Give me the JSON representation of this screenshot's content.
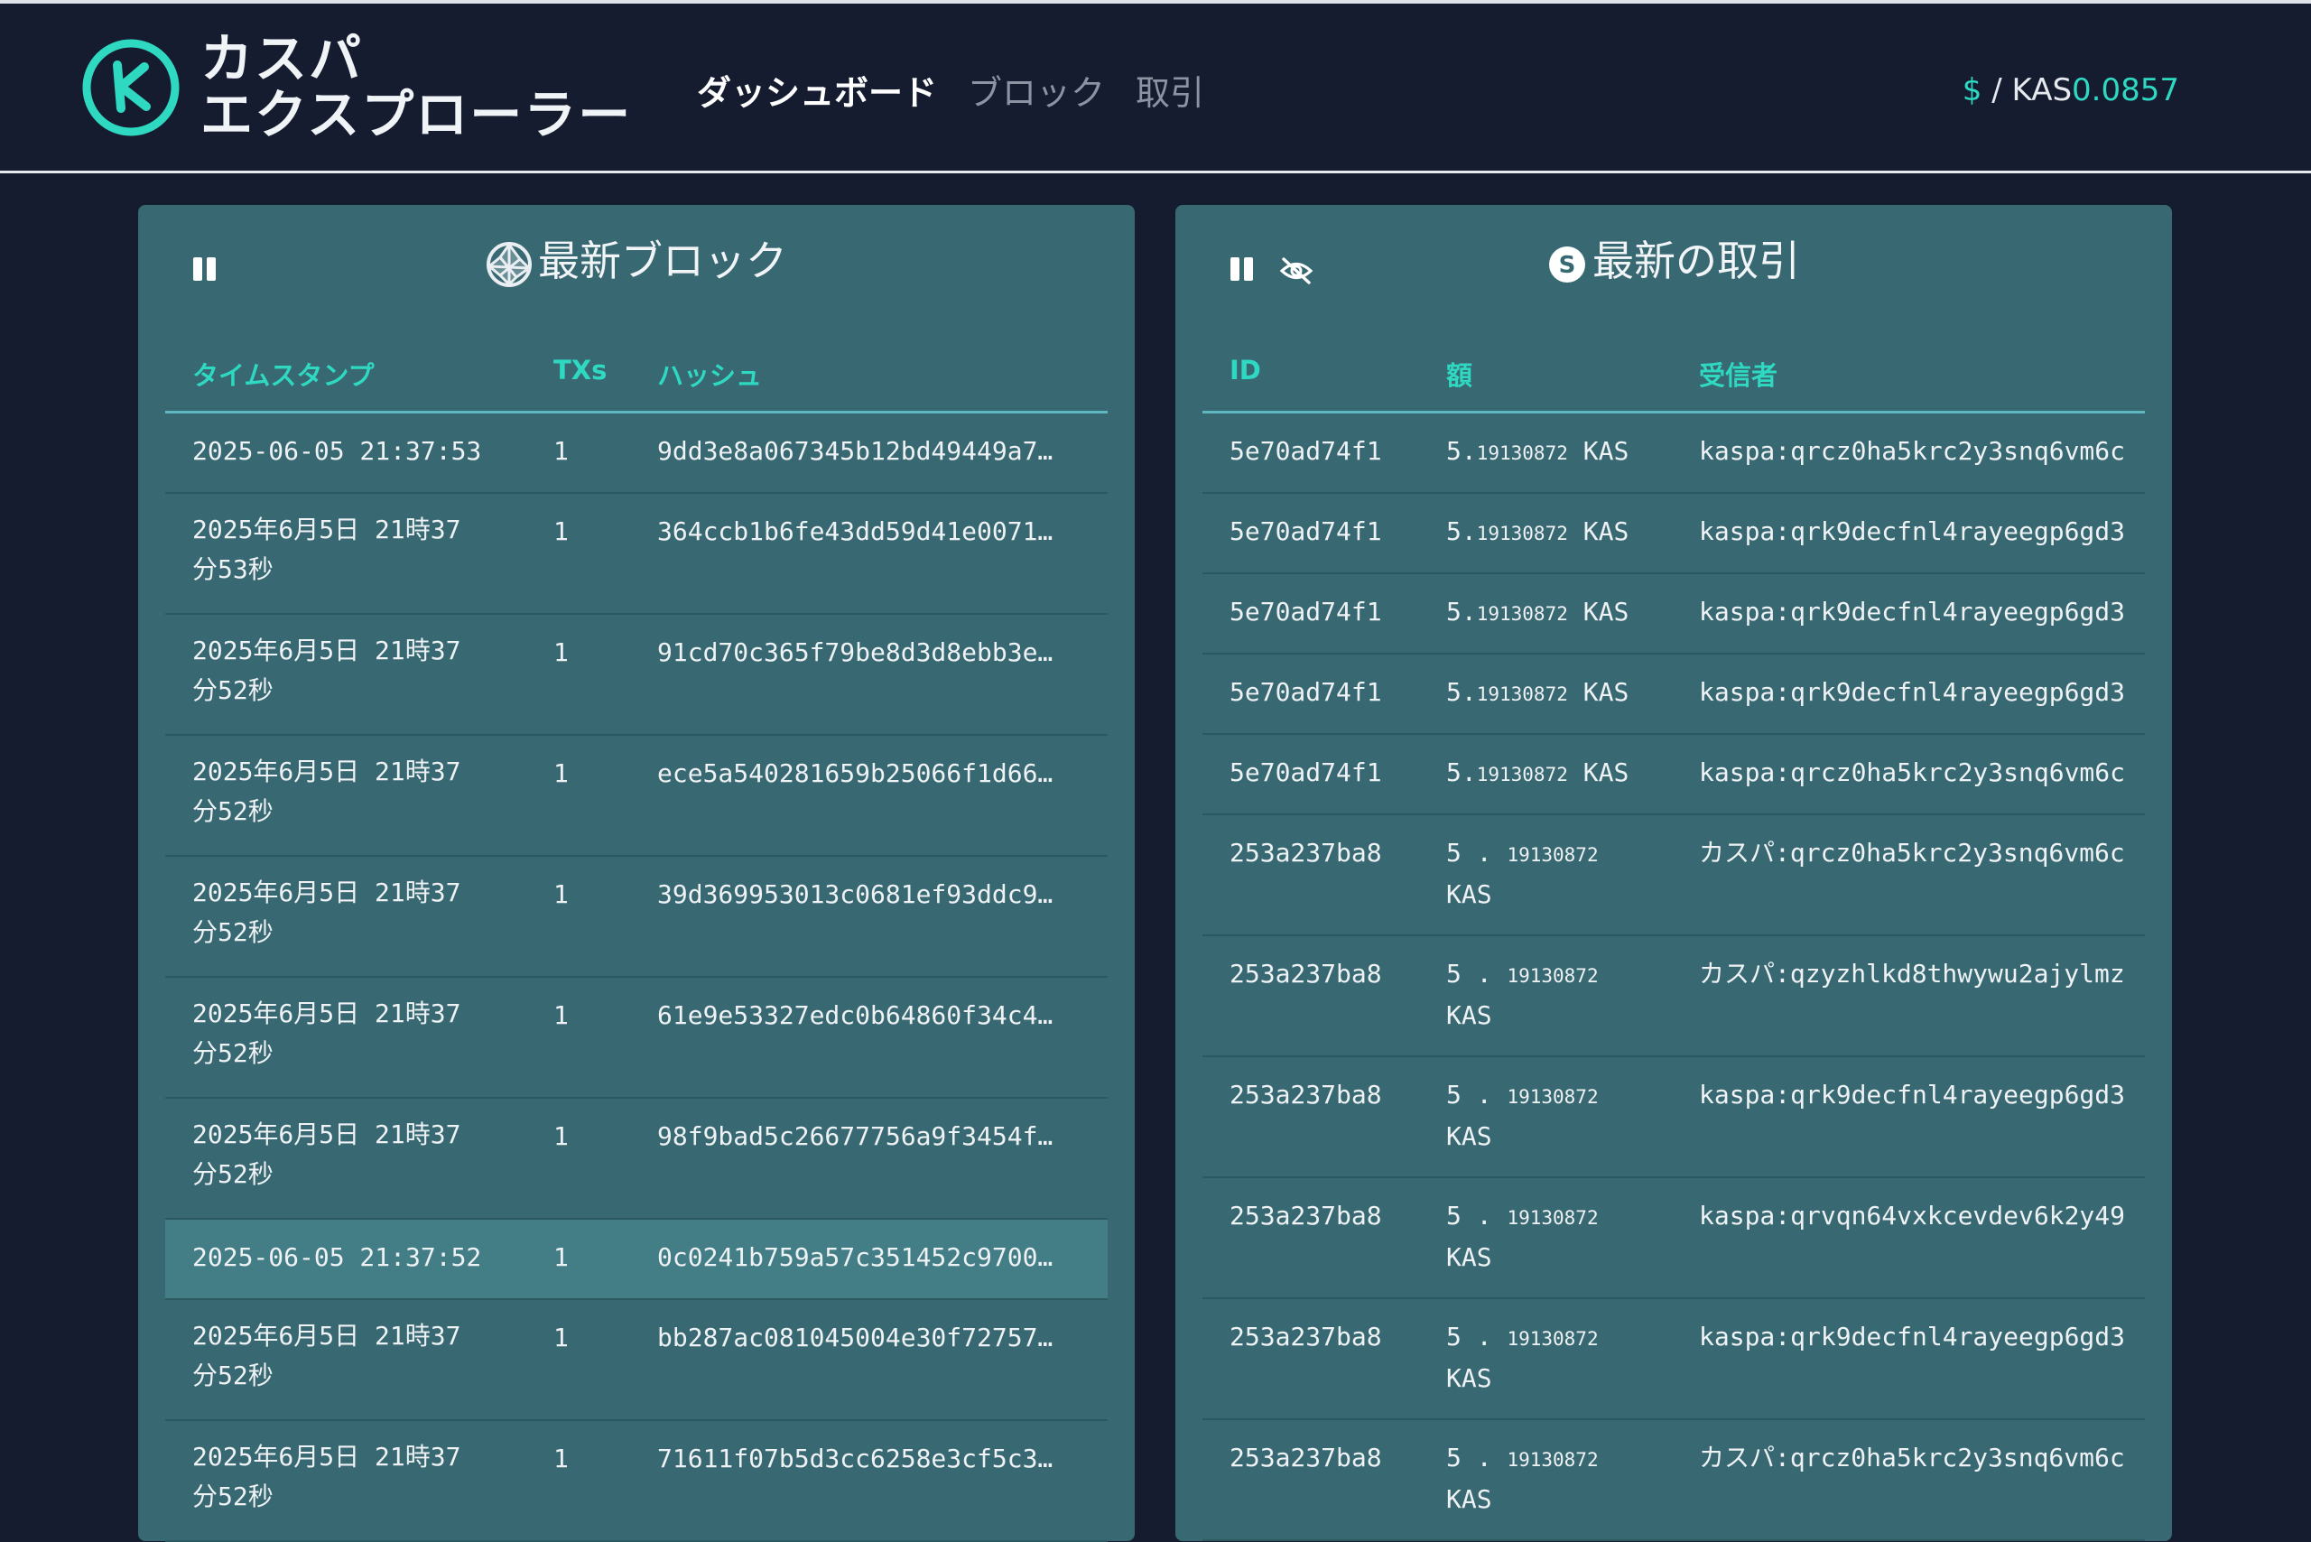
{
  "header": {
    "brand_line1": "カスパ",
    "brand_line2": "エクスプローラー",
    "nav": [
      "ダッシュボード",
      "ブロック",
      "取引"
    ],
    "price_currency": "$",
    "price_sep": " / KAS",
    "price_value": "0.0857"
  },
  "blocks_panel": {
    "title": "最新ブロック",
    "columns": [
      "タイムスタンプ",
      "TXs",
      "ハッシュ"
    ],
    "rows": [
      {
        "ts1": "2025-06-05 21:37:53",
        "ts2": "",
        "txs": "1",
        "hash": "9dd3e8a067345b12bd49449a7…"
      },
      {
        "ts1": "2025年6月5日 21時37",
        "ts2": "分53秒",
        "txs": "1",
        "hash": "364ccb1b6fe43dd59d41e0071…"
      },
      {
        "ts1": "2025年6月5日 21時37",
        "ts2": "分52秒",
        "txs": "1",
        "hash": "91cd70c365f79be8d3d8ebb3e…"
      },
      {
        "ts1": "2025年6月5日 21時37",
        "ts2": "分52秒",
        "txs": "1",
        "hash": "ece5a540281659b25066f1d66…"
      },
      {
        "ts1": "2025年6月5日 21時37",
        "ts2": "分52秒",
        "txs": "1",
        "hash": "39d369953013c0681ef93ddc9…"
      },
      {
        "ts1": "2025年6月5日 21時37",
        "ts2": "分52秒",
        "txs": "1",
        "hash": "61e9e53327edc0b64860f34c4…"
      },
      {
        "ts1": "2025年6月5日 21時37",
        "ts2": "分52秒",
        "txs": "1",
        "hash": "98f9bad5c26677756a9f3454f…"
      },
      {
        "ts1": "2025-06-05 21:37:52",
        "ts2": "",
        "txs": "1",
        "hash": "0c0241b759a57c351452c9700…"
      },
      {
        "ts1": "2025年6月5日 21時37",
        "ts2": "分52秒",
        "txs": "1",
        "hash": "bb287ac081045004e30f72757…"
      },
      {
        "ts1": "2025年6月5日 21時37",
        "ts2": "分52秒",
        "txs": "1",
        "hash": "71611f07b5d3cc6258e3cf5c3…"
      }
    ]
  },
  "tx_panel": {
    "title": "最新の取引",
    "columns": [
      "ID",
      "額",
      "受信者"
    ],
    "rows": [
      {
        "id": "5e70ad74f1",
        "amt_int": "5.",
        "amt_dec": "19130872",
        "amt_unit": " KAS",
        "to": "kaspa:qrcz0ha5krc2y3snq6vm6c"
      },
      {
        "id": "5e70ad74f1",
        "amt_int": "5.",
        "amt_dec": "19130872",
        "amt_unit": " KAS",
        "to": "kaspa:qrk9decfnl4rayeegp6gd3"
      },
      {
        "id": "5e70ad74f1",
        "amt_int": "5.",
        "amt_dec": "19130872",
        "amt_unit": " KAS",
        "to": "kaspa:qrk9decfnl4rayeegp6gd3"
      },
      {
        "id": "5e70ad74f1",
        "amt_int": "5.",
        "amt_dec": "19130872",
        "amt_unit": " KAS",
        "to": "kaspa:qrk9decfnl4rayeegp6gd3"
      },
      {
        "id": "5e70ad74f1",
        "amt_int": "5.",
        "amt_dec": "19130872",
        "amt_unit": " KAS",
        "to": "kaspa:qrcz0ha5krc2y3snq6vm6c"
      },
      {
        "id": "253a237ba8",
        "amt_int": "5 . ",
        "amt_dec": "19130872",
        "amt_unit": "KAS",
        "to": "カスパ:qrcz0ha5krc2y3snq6vm6c"
      },
      {
        "id": "253a237ba8",
        "amt_int": "5 . ",
        "amt_dec": "19130872",
        "amt_unit": "KAS",
        "to": "カスパ:qzyzhlkd8thwywu2ajylmz"
      },
      {
        "id": "253a237ba8",
        "amt_int": "5 . ",
        "amt_dec": "19130872",
        "amt_unit": "KAS",
        "to": "kaspa:qrk9decfnl4rayeegp6gd3"
      },
      {
        "id": "253a237ba8",
        "amt_int": "5 . ",
        "amt_dec": "19130872",
        "amt_unit": "KAS",
        "to": "kaspa:qrvqn64vxkcevdev6k2y49"
      },
      {
        "id": "253a237ba8",
        "amt_int": "5 . ",
        "amt_dec": "19130872",
        "amt_unit": "KAS",
        "to": "kaspa:qrk9decfnl4rayeegp6gd3"
      },
      {
        "id": "253a237ba8",
        "amt_int": "5 . ",
        "amt_dec": "19130872",
        "amt_unit": "KAS",
        "to": "カスパ:qrcz0ha5krc2y3snq6vm6c"
      }
    ]
  },
  "colors": {
    "accent": "#2fd8c0",
    "panel": "#386872",
    "bg": "#161c30"
  }
}
